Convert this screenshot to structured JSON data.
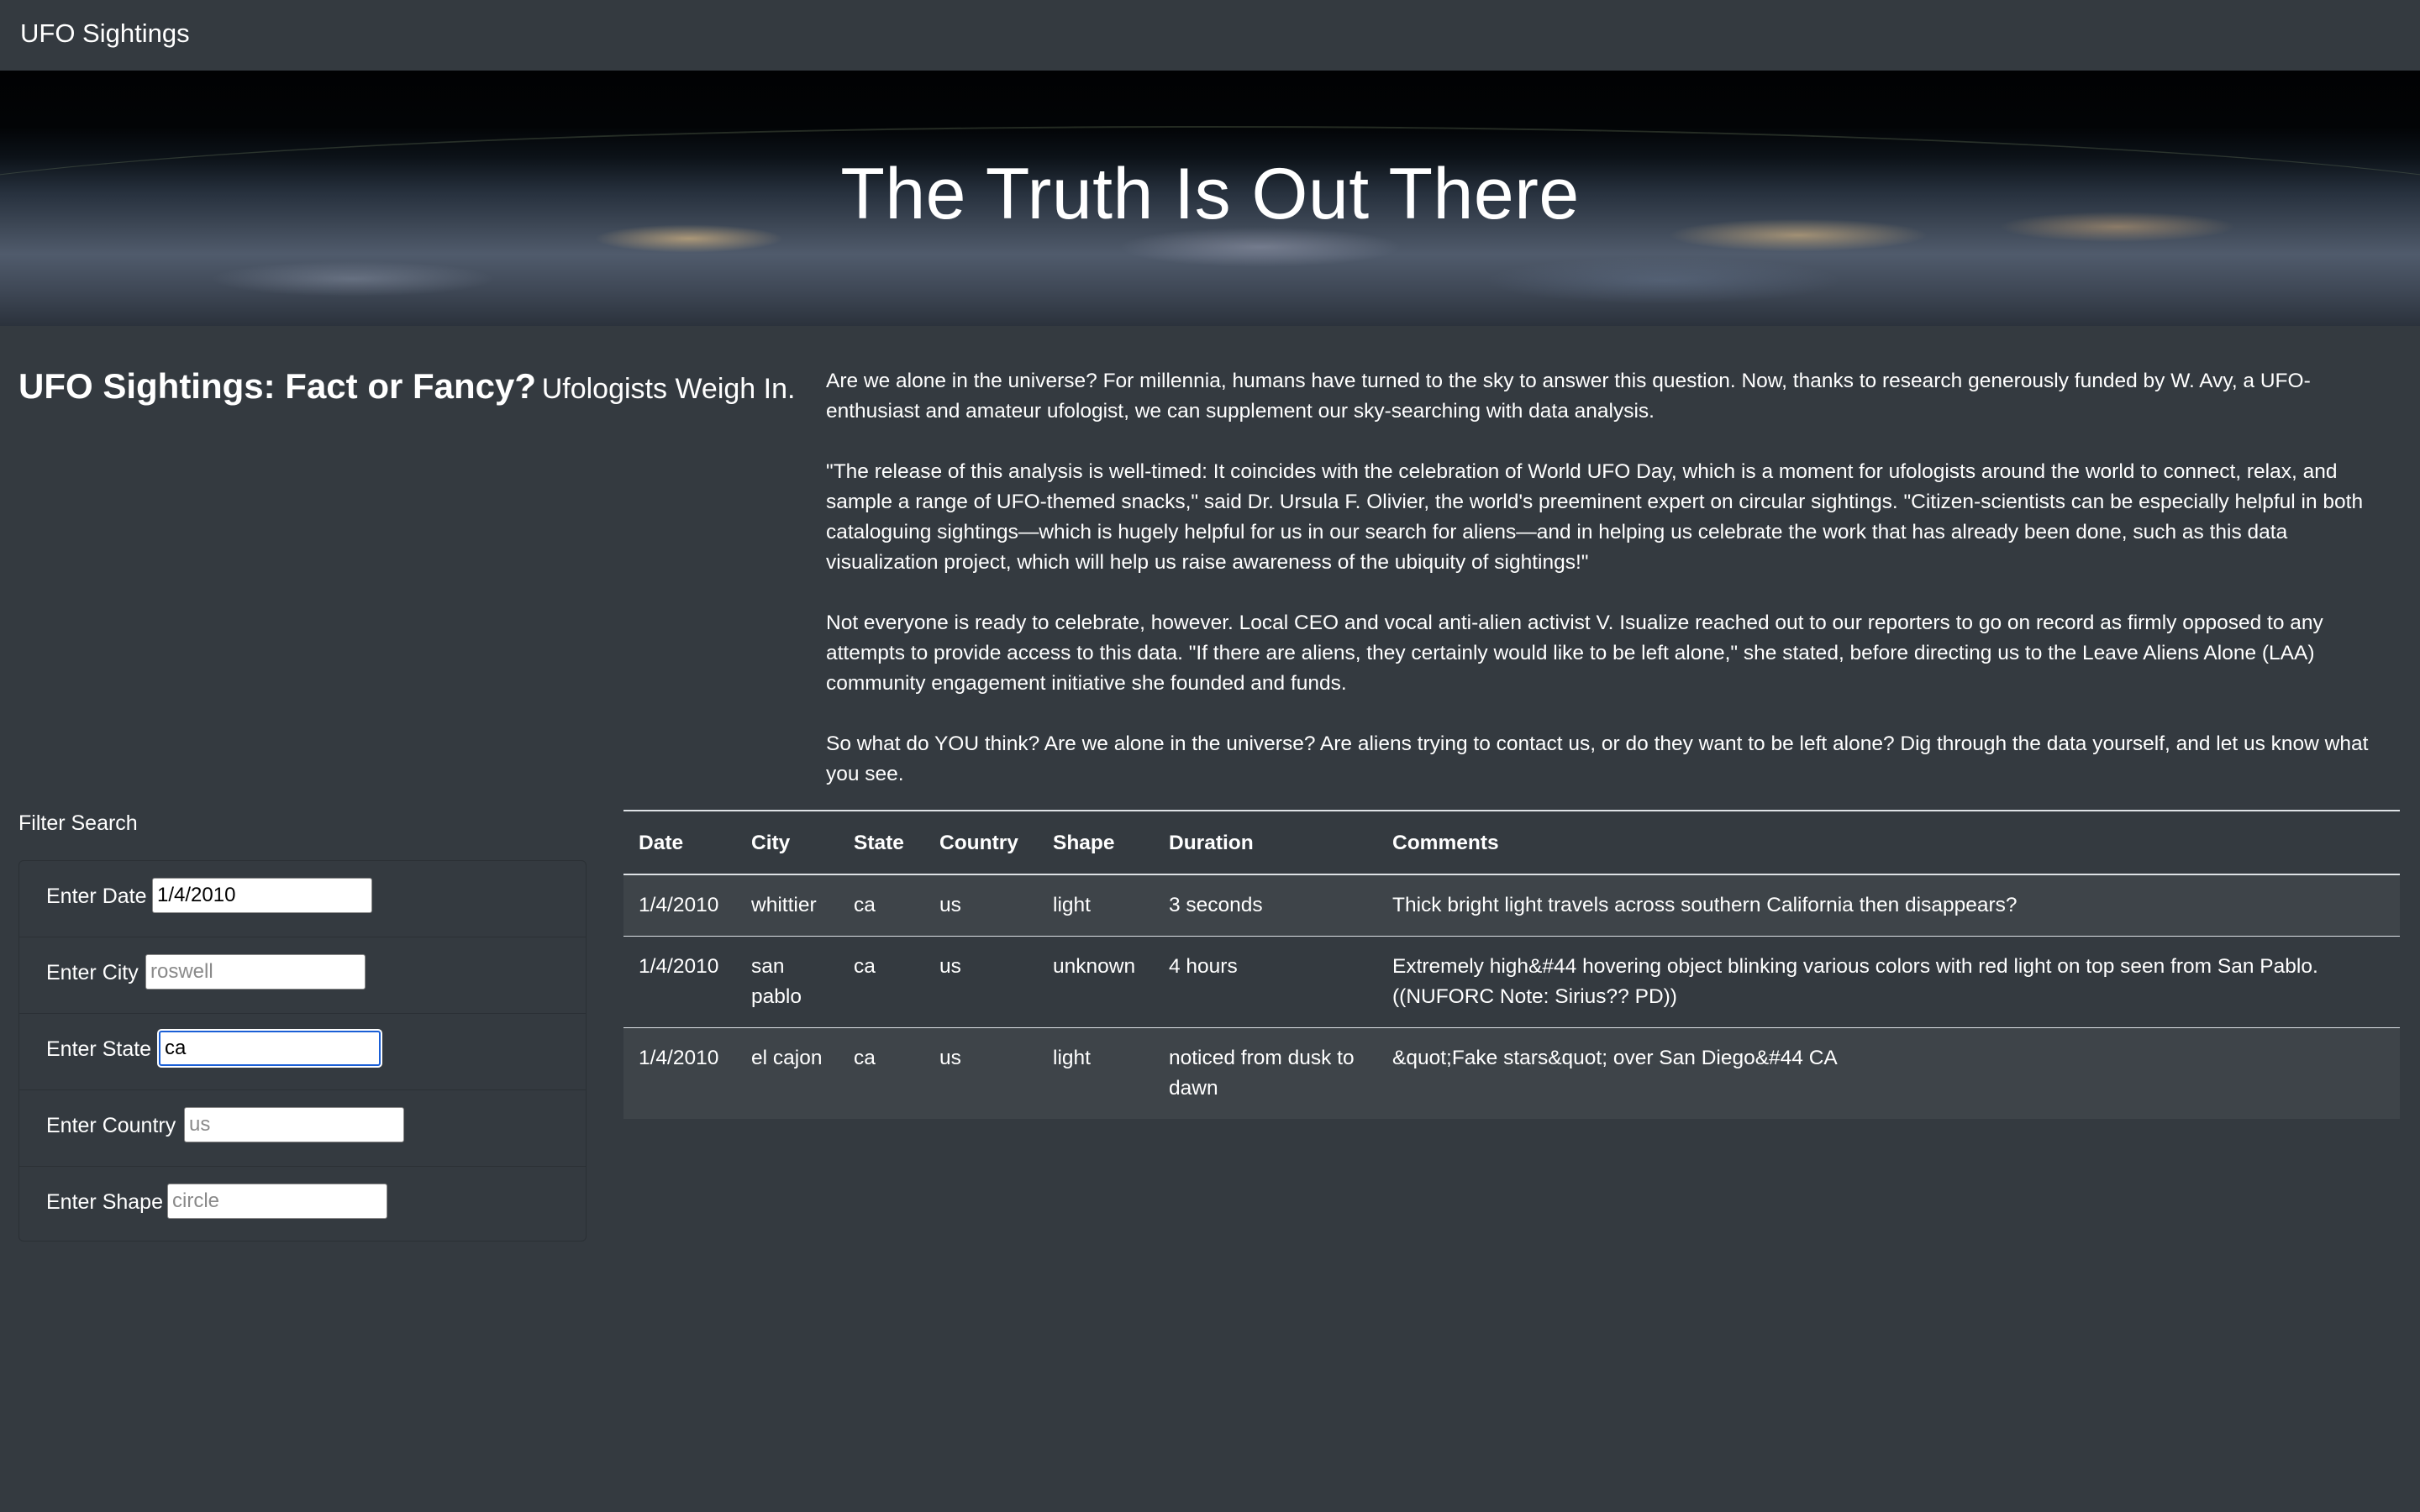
{
  "navbar": {
    "brand": "UFO Sightings"
  },
  "hero": {
    "title": "The Truth Is Out There"
  },
  "headline": {
    "main": "UFO Sightings: Fact or Fancy?",
    "sub": "Ufologists Weigh In."
  },
  "article": {
    "paragraphs": [
      "Are we alone in the universe? For millennia, humans have turned to the sky to answer this question. Now, thanks to research generously funded by W. Avy, a UFO-enthusiast and amateur ufologist, we can supplement our sky-searching with data analysis.",
      "\"The release of this analysis is well-timed: It coincides with the celebration of World UFO Day, which is a moment for ufologists around the world to connect, relax, and sample a range of UFO-themed snacks,\" said Dr. Ursula F. Olivier, the world's preeminent expert on circular sightings. \"Citizen-scientists can be especially helpful in both cataloguing sightings—which is hugely helpful for us in our search for aliens—and in helping us celebrate the work that has already been done, such as this data visualization project, which will help us raise awareness of the ubiquity of sightings!\"",
      "Not everyone is ready to celebrate, however. Local CEO and vocal anti-alien activist V. Isualize reached out to our reporters to go on record as firmly opposed to any attempts to provide access to this data. \"If there are aliens, they certainly would like to be left alone,\" she stated, before directing us to the Leave Aliens Alone (LAA) community engagement initiative she founded and funds.",
      "So what do YOU think? Are we alone in the universe? Are aliens trying to contact us, or do they want to be left alone? Dig through the data yourself, and let us know what you see."
    ]
  },
  "filters": {
    "title": "Filter Search",
    "date": {
      "label": "Enter Date",
      "value": "1/4/2010",
      "placeholder": ""
    },
    "city": {
      "label": "Enter City",
      "value": "",
      "placeholder": "roswell"
    },
    "state": {
      "label": "Enter State",
      "value": "ca",
      "placeholder": ""
    },
    "country": {
      "label": "Enter Country",
      "value": "",
      "placeholder": "us"
    },
    "shape": {
      "label": "Enter Shape",
      "value": "",
      "placeholder": "circle"
    }
  },
  "table": {
    "headers": [
      "Date",
      "City",
      "State",
      "Country",
      "Shape",
      "Duration",
      "Comments"
    ],
    "rows": [
      [
        "1/4/2010",
        "whittier",
        "ca",
        "us",
        "light",
        "3 seconds",
        "Thick bright light travels across southern California then disappears?"
      ],
      [
        "1/4/2010",
        "san pablo",
        "ca",
        "us",
        "unknown",
        "4 hours",
        "Extremely high&#44 hovering object blinking various colors with red light on top seen from San Pablo. ((NUFORC Note: Sirius?? PD))"
      ],
      [
        "1/4/2010",
        "el cajon",
        "ca",
        "us",
        "light",
        "noticed from dusk to dawn",
        "&quot;Fake stars&quot; over San Diego&#44 CA"
      ]
    ]
  }
}
